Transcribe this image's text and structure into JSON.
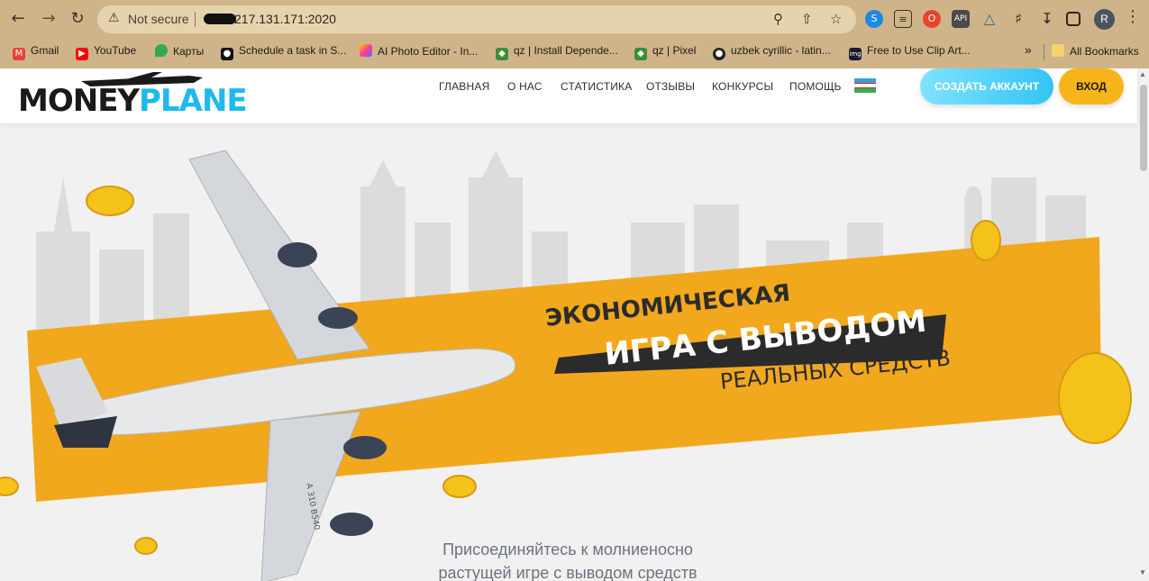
{
  "browser": {
    "back_icon": "arrow-left-icon",
    "forward_icon": "arrow-right-icon",
    "reload_icon": "reload-icon",
    "security_label": "Not secure",
    "url": "217.131.171:2020",
    "profile_initial": "R",
    "extensions": [
      "shazam",
      "reader",
      "opera",
      "API",
      "triangle",
      "puzzle",
      "download",
      "sidepanel"
    ],
    "ext_api_label": "API"
  },
  "bookmarks": {
    "items": [
      {
        "label": "Gmail",
        "icon": "gmail-icon",
        "color": "#ea4335"
      },
      {
        "label": "YouTube",
        "icon": "youtube-icon",
        "color": "#ff0000"
      },
      {
        "label": "Карты",
        "icon": "maps-icon",
        "color": "#34a853"
      },
      {
        "label": "Schedule a task in S...",
        "icon": "schedule-icon",
        "color": "#111111"
      },
      {
        "label": "AI Photo Editor - In...",
        "icon": "photo-editor-icon",
        "color": "#ff3c8e"
      },
      {
        "label": "qz | Install Depende...",
        "icon": "qz-icon",
        "color": "#3a8f3a"
      },
      {
        "label": "qz | Pixel",
        "icon": "qz-icon",
        "color": "#3a8f3a"
      },
      {
        "label": "uzbek cyrillic - latin...",
        "icon": "globe-icon",
        "color": "#222222"
      },
      {
        "label": "Free to Use Clip Art...",
        "icon": "clipart-icon",
        "color": "#1a1a2e"
      }
    ],
    "overflow_label": "»",
    "all_bookmarks_label": "All Bookmarks"
  },
  "site": {
    "logo_money": "MONEY",
    "logo_plane": "PLANE",
    "nav": [
      "ГЛАВНАЯ",
      "О НАС",
      "СТАТИСТИКА",
      "ОТЗЫВЫ",
      "КОНКУРСЫ",
      "ПОМОЩЬ"
    ],
    "signup_label": "СОЗДАТЬ АККАУНТ",
    "login_label": "ВХОД",
    "flag_icon": "uzbekistan-flag-icon"
  },
  "hero": {
    "line1": "ЭКОНОМИЧЕСКАЯ",
    "line2": "ИГРА С ВЫВОДОМ",
    "line3": "РЕАЛЬНЫХ СРЕДСТВ",
    "plane_reg": "A 310 B540",
    "tagline_line1": "Присоединяйтесь к молниеносно",
    "tagline_line2": "растущей игре с выводом средств"
  },
  "colors": {
    "chrome": "#cfb48a",
    "accent_orange": "#f2a81d",
    "accent_blue": "#1fb9ea",
    "gold": "#f5c21b"
  }
}
